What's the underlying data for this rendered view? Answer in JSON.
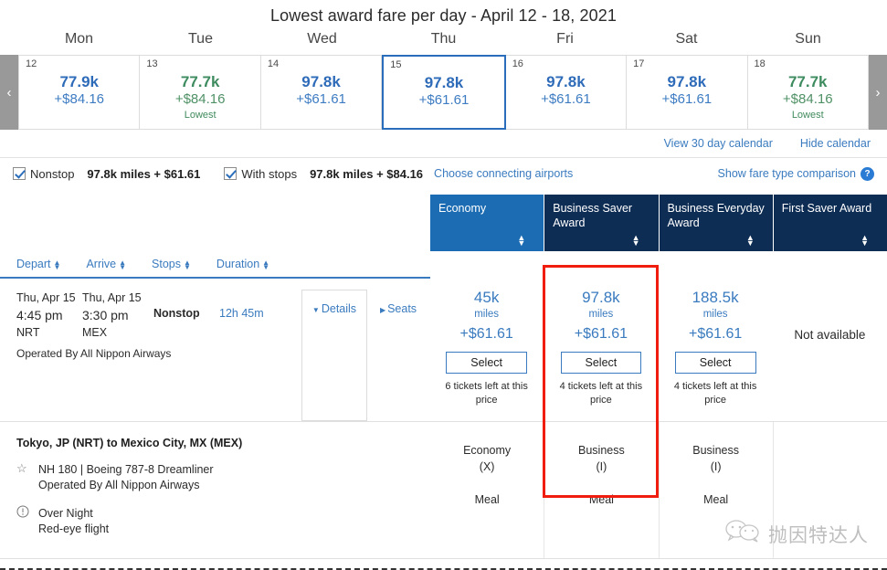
{
  "calendar": {
    "title": "Lowest award fare per day - April 12 - 18, 2021",
    "prev_arrow": "‹",
    "next_arrow": "›",
    "days_of_week": [
      "Mon",
      "Tue",
      "Wed",
      "Thu",
      "Fri",
      "Sat",
      "Sun"
    ],
    "cells": [
      {
        "day": "12",
        "miles": "77.9k",
        "cash": "+$84.16",
        "tag": "",
        "lowest": false,
        "selected": false
      },
      {
        "day": "13",
        "miles": "77.7k",
        "cash": "+$84.16",
        "tag": "Lowest",
        "lowest": true,
        "selected": false
      },
      {
        "day": "14",
        "miles": "97.8k",
        "cash": "+$61.61",
        "tag": "",
        "lowest": false,
        "selected": false
      },
      {
        "day": "15",
        "miles": "97.8k",
        "cash": "+$61.61",
        "tag": "",
        "lowest": false,
        "selected": true
      },
      {
        "day": "16",
        "miles": "97.8k",
        "cash": "+$61.61",
        "tag": "",
        "lowest": false,
        "selected": false
      },
      {
        "day": "17",
        "miles": "97.8k",
        "cash": "+$61.61",
        "tag": "",
        "lowest": false,
        "selected": false
      },
      {
        "day": "18",
        "miles": "77.7k",
        "cash": "+$84.16",
        "tag": "Lowest",
        "lowest": true,
        "selected": false
      }
    ],
    "view_30_day": "View 30 day calendar",
    "hide_calendar": "Hide calendar"
  },
  "filters": {
    "nonstop_label": "Nonstop",
    "nonstop_fare": "97.8k miles + $61.61",
    "nonstop_checked": true,
    "withstops_label": "With stops",
    "withstops_fare": "97.8k miles + $84.16",
    "withstops_checked": true,
    "choose_airports": "Choose connecting airports",
    "fare_comparison": "Show fare type comparison",
    "help_glyph": "?"
  },
  "sort": {
    "items": [
      "Depart",
      "Arrive",
      "Stops",
      "Duration"
    ]
  },
  "fare_columns": [
    {
      "name": "Economy",
      "active": true
    },
    {
      "name": "Business Saver Award",
      "active": false
    },
    {
      "name": "Business Everyday Award",
      "active": false
    },
    {
      "name": "First Saver Award",
      "active": false
    }
  ],
  "flight": {
    "depart_date": "Thu, Apr 15",
    "depart_time": "4:45 pm",
    "depart_airport": "NRT",
    "arrive_date": "Thu, Apr 15",
    "arrive_time": "3:30 pm",
    "arrive_airport": "MEX",
    "stops": "Nonstop",
    "duration": "12h 45m",
    "operated_by": "Operated By All Nippon Airways",
    "details_tab": "Details",
    "seats_tab": "Seats",
    "fares": [
      {
        "miles": "45k",
        "miles_word": "miles",
        "cash": "+$61.61",
        "button": "Select",
        "tickets": "6 tickets left at this price",
        "available": true
      },
      {
        "miles": "97.8k",
        "miles_word": "miles",
        "cash": "+$61.61",
        "button": "Select",
        "tickets": "4 tickets left at this price",
        "available": true
      },
      {
        "miles": "188.5k",
        "miles_word": "miles",
        "cash": "+$61.61",
        "button": "Select",
        "tickets": "4 tickets left at this price",
        "available": true
      },
      {
        "miles": "",
        "miles_word": "",
        "cash": "",
        "button": "",
        "tickets": "",
        "available": false,
        "unavailable_text": "Not available"
      }
    ]
  },
  "details_panel": {
    "route": "Tokyo, JP (NRT) to Mexico City, MX (MEX)",
    "star_icon": "☆",
    "flight_info": "NH 180 | Boeing 787-8 Dreamliner",
    "operated_by": "Operated By All Nippon Airways",
    "warning_icon": "!",
    "overnight_title": "Over Night",
    "overnight_sub": "Red-eye flight",
    "cabins": [
      {
        "cabin": "Economy",
        "code": "(X)",
        "service": "Meal"
      },
      {
        "cabin": "Business",
        "code": "(I)",
        "service": "Meal"
      },
      {
        "cabin": "Business",
        "code": "(I)",
        "service": "Meal"
      },
      {
        "cabin": "",
        "code": "",
        "service": ""
      }
    ]
  },
  "watermark": {
    "text": "抛因特达人"
  },
  "colors": {
    "accent_blue": "#3a7bbf",
    "header_navy": "#0e2d54",
    "active_blue": "#1b6cb3",
    "lowest_green": "#3d8b5f",
    "highlight_red": "#f01c0e"
  }
}
